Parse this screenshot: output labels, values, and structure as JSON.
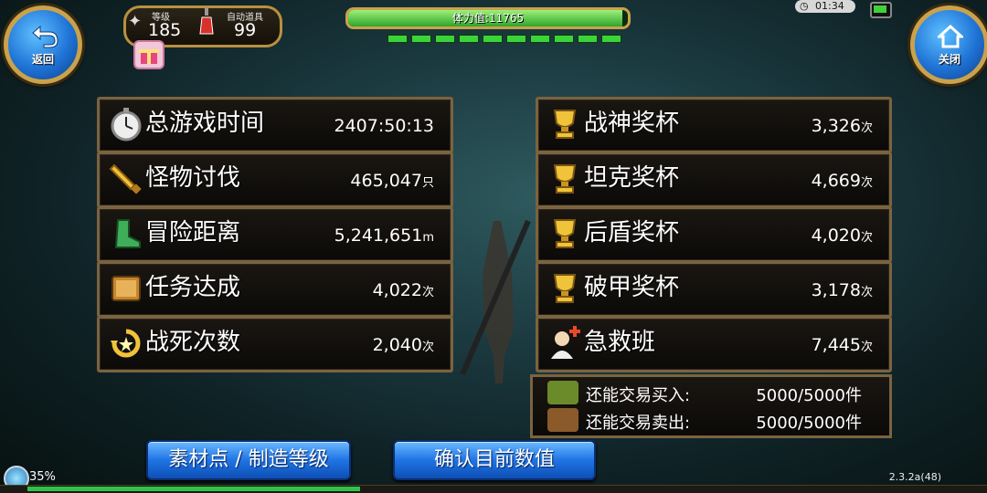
{
  "buttons": {
    "back": "返回",
    "close": "关闭",
    "materials": "素材点 / 制造等级",
    "confirm": "确认目前数值"
  },
  "status": {
    "level_label": "等级",
    "level_value": "185",
    "auto_item_label": "自动道具",
    "auto_item_value": "99",
    "stamina_text": "体力值:11765",
    "stamina_fraction": 0.98,
    "clock": "01:34",
    "loading_percent": "35%",
    "loading_fraction": 0.35,
    "version": "2.3.2a(48)"
  },
  "left_stats": [
    {
      "label": "总游戏时间",
      "value": "2407:50:13",
      "unit": ""
    },
    {
      "label": "怪物讨伐",
      "value": "465,047",
      "unit": "只"
    },
    {
      "label": "冒险距离",
      "value": "5,241,651",
      "unit": "m"
    },
    {
      "label": "任务达成",
      "value": "4,022",
      "unit": "次"
    },
    {
      "label": "战死次数",
      "value": "2,040",
      "unit": "次"
    }
  ],
  "right_stats": [
    {
      "label": "战神奖杯",
      "value": "3,326",
      "unit": "次"
    },
    {
      "label": "坦克奖杯",
      "value": "4,669",
      "unit": "次"
    },
    {
      "label": "后盾奖杯",
      "value": "4,020",
      "unit": "次"
    },
    {
      "label": "破甲奖杯",
      "value": "3,178",
      "unit": "次"
    },
    {
      "label": "急救班",
      "value": "7,445",
      "unit": "次"
    }
  ],
  "trade": [
    {
      "label": "还能交易买入:",
      "value": "5000/5000件"
    },
    {
      "label": "还能交易卖出:",
      "value": "5000/5000件"
    }
  ],
  "icons": {
    "left": [
      "stopwatch-icon",
      "sword-icon",
      "boot-icon",
      "book-icon",
      "revive-icon"
    ],
    "right": [
      "trophy-icon",
      "trophy-icon",
      "trophy-icon",
      "trophy-icon",
      "medic-icon"
    ]
  },
  "colors": {
    "accent_gold": "#c9a24c",
    "button_blue": "#1f74e4",
    "stamina_green": "#3cd33a"
  }
}
